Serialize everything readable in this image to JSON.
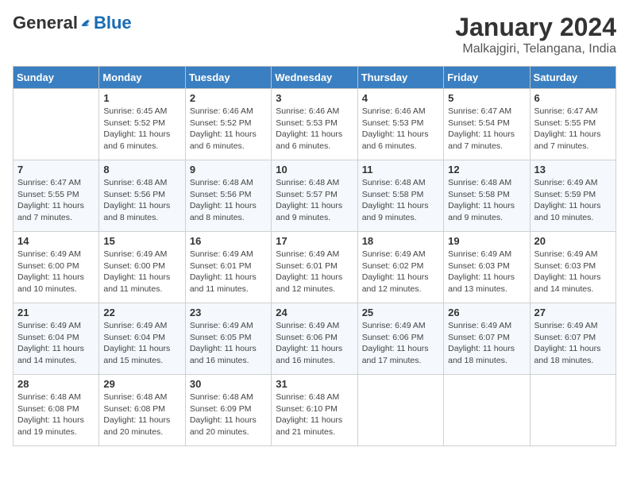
{
  "header": {
    "logo_general": "General",
    "logo_blue": "Blue",
    "month_year": "January 2024",
    "location": "Malkajgiri, Telangana, India"
  },
  "weekdays": [
    "Sunday",
    "Monday",
    "Tuesday",
    "Wednesday",
    "Thursday",
    "Friday",
    "Saturday"
  ],
  "weeks": [
    [
      {
        "day": "",
        "info": ""
      },
      {
        "day": "1",
        "info": "Sunrise: 6:45 AM\nSunset: 5:52 PM\nDaylight: 11 hours and 6 minutes."
      },
      {
        "day": "2",
        "info": "Sunrise: 6:46 AM\nSunset: 5:52 PM\nDaylight: 11 hours and 6 minutes."
      },
      {
        "day": "3",
        "info": "Sunrise: 6:46 AM\nSunset: 5:53 PM\nDaylight: 11 hours and 6 minutes."
      },
      {
        "day": "4",
        "info": "Sunrise: 6:46 AM\nSunset: 5:53 PM\nDaylight: 11 hours and 6 minutes."
      },
      {
        "day": "5",
        "info": "Sunrise: 6:47 AM\nSunset: 5:54 PM\nDaylight: 11 hours and 7 minutes."
      },
      {
        "day": "6",
        "info": "Sunrise: 6:47 AM\nSunset: 5:55 PM\nDaylight: 11 hours and 7 minutes."
      }
    ],
    [
      {
        "day": "7",
        "info": "Sunrise: 6:47 AM\nSunset: 5:55 PM\nDaylight: 11 hours and 7 minutes."
      },
      {
        "day": "8",
        "info": "Sunrise: 6:48 AM\nSunset: 5:56 PM\nDaylight: 11 hours and 8 minutes."
      },
      {
        "day": "9",
        "info": "Sunrise: 6:48 AM\nSunset: 5:56 PM\nDaylight: 11 hours and 8 minutes."
      },
      {
        "day": "10",
        "info": "Sunrise: 6:48 AM\nSunset: 5:57 PM\nDaylight: 11 hours and 9 minutes."
      },
      {
        "day": "11",
        "info": "Sunrise: 6:48 AM\nSunset: 5:58 PM\nDaylight: 11 hours and 9 minutes."
      },
      {
        "day": "12",
        "info": "Sunrise: 6:48 AM\nSunset: 5:58 PM\nDaylight: 11 hours and 9 minutes."
      },
      {
        "day": "13",
        "info": "Sunrise: 6:49 AM\nSunset: 5:59 PM\nDaylight: 11 hours and 10 minutes."
      }
    ],
    [
      {
        "day": "14",
        "info": "Sunrise: 6:49 AM\nSunset: 6:00 PM\nDaylight: 11 hours and 10 minutes."
      },
      {
        "day": "15",
        "info": "Sunrise: 6:49 AM\nSunset: 6:00 PM\nDaylight: 11 hours and 11 minutes."
      },
      {
        "day": "16",
        "info": "Sunrise: 6:49 AM\nSunset: 6:01 PM\nDaylight: 11 hours and 11 minutes."
      },
      {
        "day": "17",
        "info": "Sunrise: 6:49 AM\nSunset: 6:01 PM\nDaylight: 11 hours and 12 minutes."
      },
      {
        "day": "18",
        "info": "Sunrise: 6:49 AM\nSunset: 6:02 PM\nDaylight: 11 hours and 12 minutes."
      },
      {
        "day": "19",
        "info": "Sunrise: 6:49 AM\nSunset: 6:03 PM\nDaylight: 11 hours and 13 minutes."
      },
      {
        "day": "20",
        "info": "Sunrise: 6:49 AM\nSunset: 6:03 PM\nDaylight: 11 hours and 14 minutes."
      }
    ],
    [
      {
        "day": "21",
        "info": "Sunrise: 6:49 AM\nSunset: 6:04 PM\nDaylight: 11 hours and 14 minutes."
      },
      {
        "day": "22",
        "info": "Sunrise: 6:49 AM\nSunset: 6:04 PM\nDaylight: 11 hours and 15 minutes."
      },
      {
        "day": "23",
        "info": "Sunrise: 6:49 AM\nSunset: 6:05 PM\nDaylight: 11 hours and 16 minutes."
      },
      {
        "day": "24",
        "info": "Sunrise: 6:49 AM\nSunset: 6:06 PM\nDaylight: 11 hours and 16 minutes."
      },
      {
        "day": "25",
        "info": "Sunrise: 6:49 AM\nSunset: 6:06 PM\nDaylight: 11 hours and 17 minutes."
      },
      {
        "day": "26",
        "info": "Sunrise: 6:49 AM\nSunset: 6:07 PM\nDaylight: 11 hours and 18 minutes."
      },
      {
        "day": "27",
        "info": "Sunrise: 6:49 AM\nSunset: 6:07 PM\nDaylight: 11 hours and 18 minutes."
      }
    ],
    [
      {
        "day": "28",
        "info": "Sunrise: 6:48 AM\nSunset: 6:08 PM\nDaylight: 11 hours and 19 minutes."
      },
      {
        "day": "29",
        "info": "Sunrise: 6:48 AM\nSunset: 6:08 PM\nDaylight: 11 hours and 20 minutes."
      },
      {
        "day": "30",
        "info": "Sunrise: 6:48 AM\nSunset: 6:09 PM\nDaylight: 11 hours and 20 minutes."
      },
      {
        "day": "31",
        "info": "Sunrise: 6:48 AM\nSunset: 6:10 PM\nDaylight: 11 hours and 21 minutes."
      },
      {
        "day": "",
        "info": ""
      },
      {
        "day": "",
        "info": ""
      },
      {
        "day": "",
        "info": ""
      }
    ]
  ]
}
